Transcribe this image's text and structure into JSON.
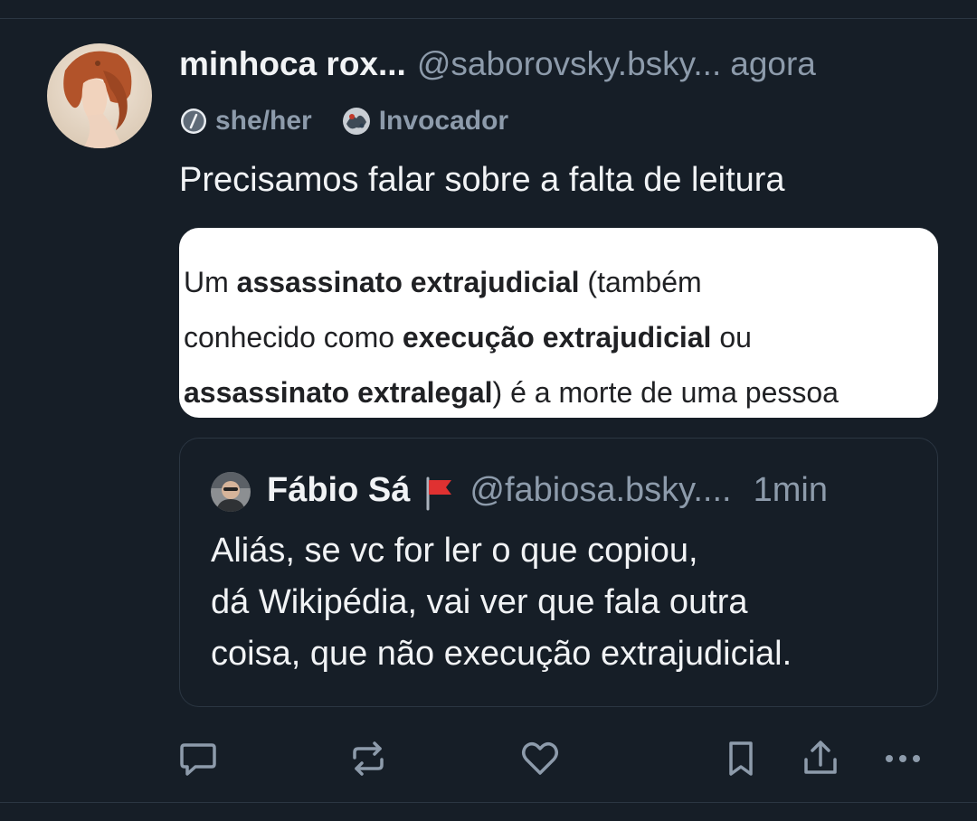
{
  "post": {
    "author": {
      "display_name": "minhoca rox...",
      "handle": "@saborovsky.bsky...",
      "timestamp": "agora",
      "avatar_icon": "portrait-avatar"
    },
    "labels": [
      {
        "icon": "pronoun-icon",
        "text": "she/her"
      },
      {
        "icon": "badge-avatar-icon",
        "text": "Invocador"
      }
    ],
    "text": "Precisamos falar sobre a falta de leitura",
    "image": {
      "description_lines": [
        [
          {
            "t": "Um ",
            "b": false
          },
          {
            "t": "assassinato extrajudicial",
            "b": true
          },
          {
            "t": " (também",
            "b": false
          }
        ],
        [
          {
            "t": "conhecido como ",
            "b": false
          },
          {
            "t": "execução extrajudicial",
            "b": true
          },
          {
            "t": " ou",
            "b": false
          }
        ],
        [
          {
            "t": "assassinato extralegal",
            "b": true
          },
          {
            "t": ") é a morte de uma pessoa",
            "b": false
          }
        ]
      ]
    },
    "quote": {
      "display_name": "Fábio Sá",
      "flag_icon": "red-flag-icon",
      "handle": "@fabiosa.bsky....",
      "timestamp": "1min",
      "lines": [
        "Aliás, se vc for ler o que copiou,",
        "dá Wikipédia, vai ver que fala outra",
        "coisa, que não execução extrajudicial."
      ]
    },
    "actions": [
      "reply-icon",
      "repost-icon",
      "like-icon",
      "bookmark-icon",
      "share-icon",
      "more-icon"
    ]
  },
  "colors": {
    "background": "#161e27",
    "text_primary": "#f1f3f5",
    "text_secondary": "#8d9bab",
    "divider": "#2b3642",
    "flag_red": "#e03131"
  }
}
